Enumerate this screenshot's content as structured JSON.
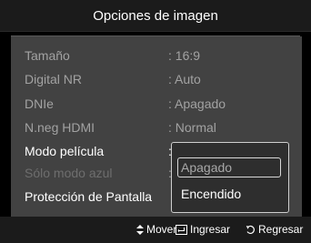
{
  "header": {
    "title": "Opciones de imagen"
  },
  "menu": {
    "items": [
      {
        "label": "Tamaño",
        "value": ": 16:9"
      },
      {
        "label": "Digital NR",
        "value": ": Auto"
      },
      {
        "label": "DNIe",
        "value": ": Apagado"
      },
      {
        "label": "N.neg HDMI",
        "value": ": Normal"
      },
      {
        "label": "Modo película",
        "value": ":"
      },
      {
        "label": "Sólo modo azul",
        "value": ":"
      },
      {
        "label": "Protección de Pantalla",
        "value": ""
      }
    ]
  },
  "dropdown": {
    "options": [
      "Apagado",
      "Encendido"
    ],
    "selected": "Apagado"
  },
  "footer": {
    "move": "Mover",
    "enter": "Ingresar",
    "back": "Regresar"
  }
}
